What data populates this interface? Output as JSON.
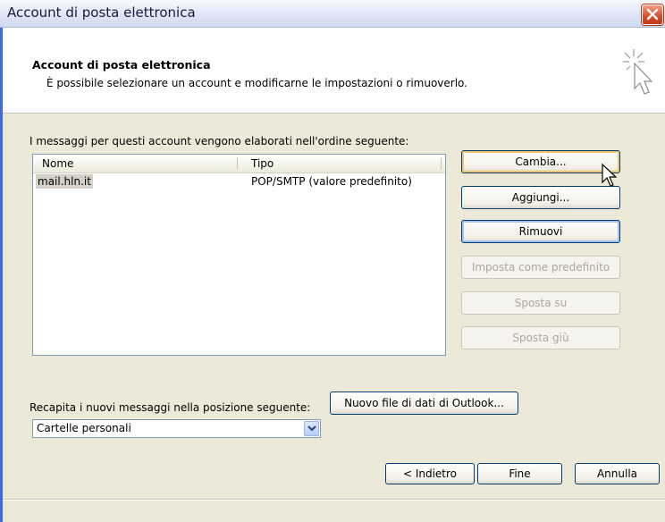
{
  "window": {
    "title": "Account di posta elettronica"
  },
  "header": {
    "title": "Account di posta elettronica",
    "subtitle": "È possibile selezionare un account e modificarne le impostazioni o rimuoverlo."
  },
  "accounts": {
    "caption": "I messaggi per questi account vengono elaborati nell'ordine seguente:",
    "columns": [
      "Nome",
      "Tipo"
    ],
    "rows": [
      {
        "name": "mail.hln.it",
        "type": "POP/SMTP (valore predefinito)"
      }
    ]
  },
  "actions": {
    "change": "Cambia...",
    "add": "Aggiungi...",
    "remove": "Rimuovi",
    "set_default": "Imposta come predefinito",
    "move_up": "Sposta su",
    "move_down": "Sposta giù"
  },
  "delivery": {
    "caption": "Recapita i nuovi messaggi nella posizione seguente:",
    "selected": "Cartelle personali",
    "new_file_button": "Nuovo file di dati di Outlook..."
  },
  "footer": {
    "back": "< Indietro",
    "finish": "Fine",
    "cancel": "Annulla"
  },
  "colors": {
    "accent": "#3f6bd6",
    "close": "#d8482a",
    "dialog_bg": "#ece9d8"
  }
}
